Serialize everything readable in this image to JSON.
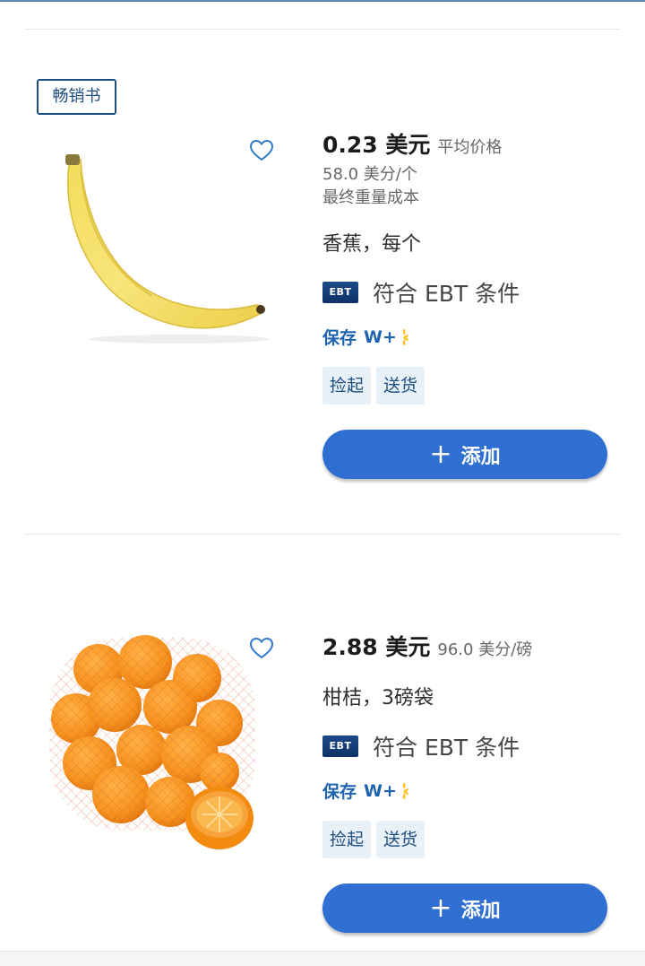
{
  "products": [
    {
      "badge": "畅销书",
      "price": "0.23 美元",
      "price_note": "平均价格",
      "unit_price": "58.0 美分/个",
      "weight_note": "最终重量成本",
      "name": "香蕉，每个",
      "ebt_logo": "EBT",
      "ebt_text": "符合 EBT 条件",
      "save_label": "保存",
      "wplus_label": "W+",
      "chips": [
        "捡起",
        "送货"
      ],
      "add_label": "添加",
      "image": "banana",
      "favorite_icon": "heart-outline-icon"
    },
    {
      "price": "2.88 美元",
      "price_note": "96.0 美分/磅",
      "name": "柑桔，3磅袋",
      "ebt_logo": "EBT",
      "ebt_text": "符合 EBT 条件",
      "save_label": "保存",
      "wplus_label": "W+",
      "chips": [
        "捡起",
        "送货"
      ],
      "add_label": "添加",
      "image": "mandarins-bag",
      "favorite_icon": "heart-outline-icon"
    }
  ],
  "colors": {
    "accent": "#2f6fd1",
    "badge_border": "#1d4e7e",
    "chip_bg": "#e8f0f8",
    "walmart_spark": "#ffc220"
  }
}
